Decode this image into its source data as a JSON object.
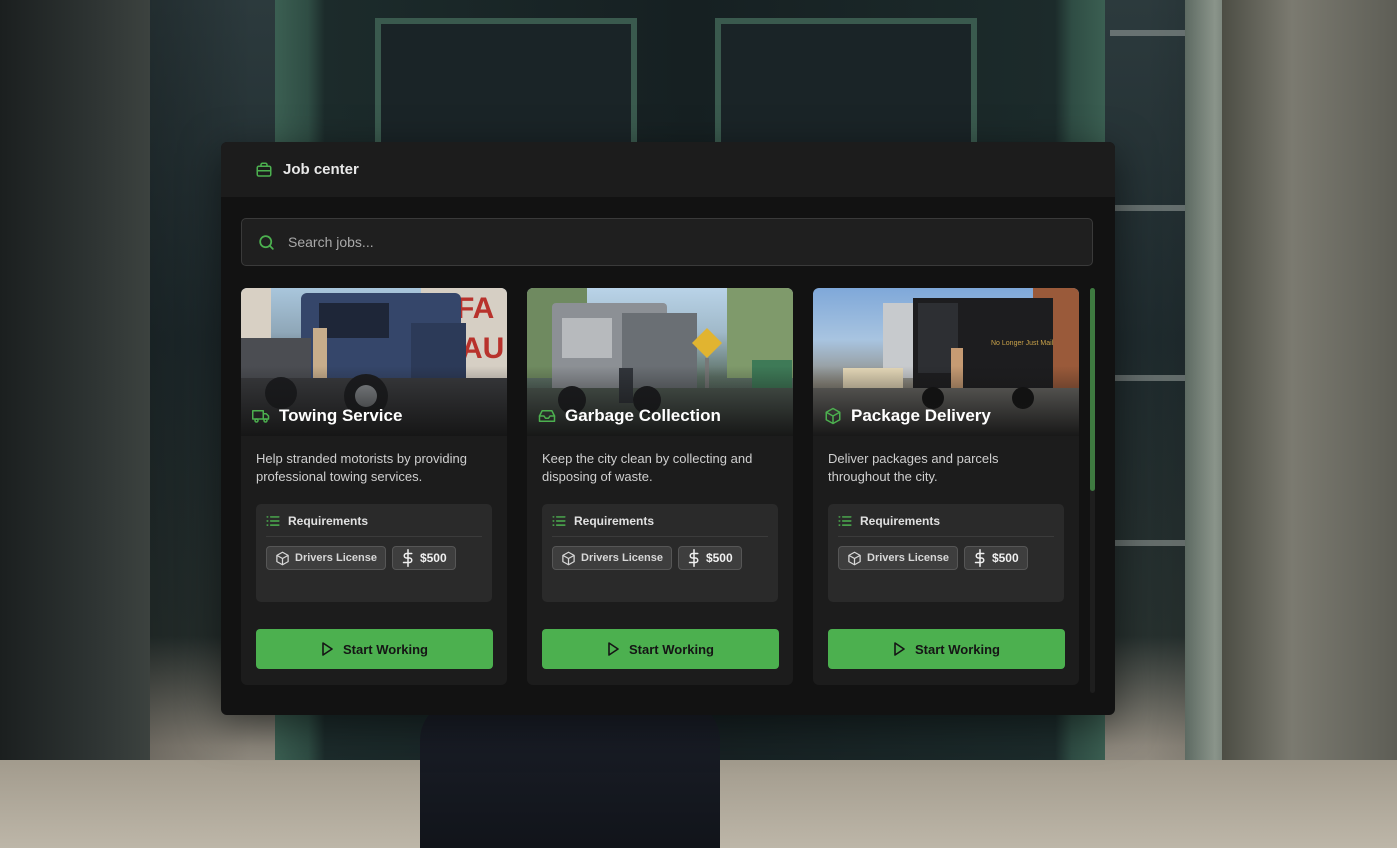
{
  "panel": {
    "title": "Job center",
    "title_icon": "briefcase-icon",
    "accent_color": "#4cb04f"
  },
  "search": {
    "placeholder": "Search jobs...",
    "value": "",
    "icon": "search-icon"
  },
  "jobs": [
    {
      "title": "Towing Service",
      "icon": "truck-icon",
      "description": "Help stranded motorists by providing professional towing services.",
      "requirements_label": "Requirements",
      "requirements": [
        {
          "icon": "box-icon",
          "label": "Drivers License"
        },
        {
          "icon": "dollar-icon",
          "label": "$500"
        }
      ],
      "button_label": "Start Working"
    },
    {
      "title": "Garbage Collection",
      "icon": "inbox-icon",
      "description": "Keep the city clean by collecting and disposing of waste.",
      "requirements_label": "Requirements",
      "requirements": [
        {
          "icon": "box-icon",
          "label": "Drivers License"
        },
        {
          "icon": "dollar-icon",
          "label": "$500"
        }
      ],
      "button_label": "Start Working"
    },
    {
      "title": "Package Delivery",
      "icon": "package-icon",
      "description": "Deliver packages and parcels throughout the city.",
      "requirements_label": "Requirements",
      "requirements": [
        {
          "icon": "box-icon",
          "label": "Drivers License"
        },
        {
          "icon": "dollar-icon",
          "label": "$500"
        }
      ],
      "button_label": "Start Working"
    }
  ]
}
